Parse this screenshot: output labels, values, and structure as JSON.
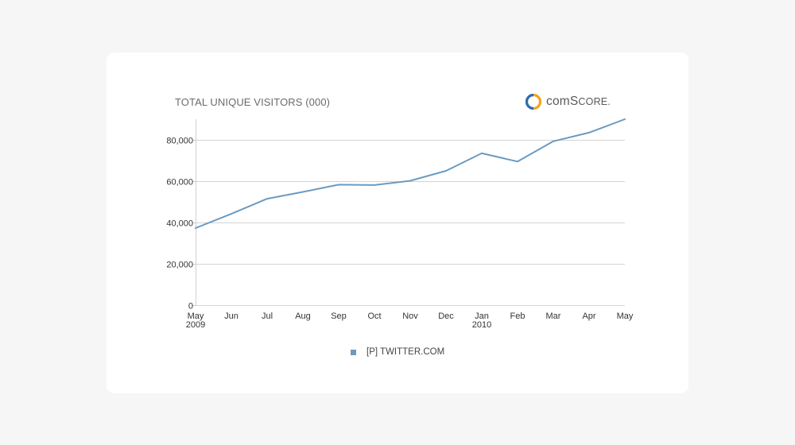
{
  "brand": {
    "logo_text_main": "comS",
    "logo_text_small": "CORE",
    "logo_dot": ".",
    "logo_colors": {
      "orange": "#f5a21b",
      "blue": "#2d6db3"
    }
  },
  "chart_data": {
    "type": "line",
    "title": "TOTAL UNIQUE VISITORS (000)",
    "xlabel": "",
    "ylabel": "",
    "categories": [
      "May",
      "Jun",
      "Jul",
      "Aug",
      "Sep",
      "Oct",
      "Nov",
      "Dec",
      "Jan",
      "Feb",
      "Mar",
      "Apr",
      "May"
    ],
    "category_sublabels": [
      "2009",
      "",
      "",
      "",
      "",
      "",
      "",
      "",
      "2010",
      "",
      "",
      "",
      ""
    ],
    "series": [
      {
        "name": "[P] TWITTER.COM",
        "color": "#6a9bc3",
        "values": [
          37300,
          44200,
          51500,
          54800,
          58300,
          58100,
          60200,
          65000,
          73500,
          69500,
          79300,
          83500,
          90000
        ]
      }
    ],
    "ylim": [
      0,
      90000
    ],
    "yticks": [
      0,
      20000,
      40000,
      60000,
      80000
    ],
    "ytick_labels": [
      "0",
      "20,000",
      "40,000",
      "60,000",
      "80,000"
    ],
    "grid": true,
    "legend_position": "bottom-center"
  }
}
